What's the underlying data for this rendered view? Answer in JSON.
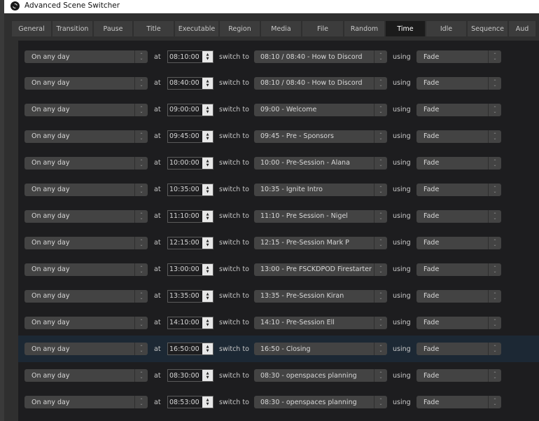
{
  "window": {
    "title": "Advanced Scene Switcher"
  },
  "tabs": [
    {
      "label": "General",
      "active": false
    },
    {
      "label": "Transition",
      "active": false
    },
    {
      "label": "Pause",
      "active": false
    },
    {
      "label": "Title",
      "active": false
    },
    {
      "label": "Executable",
      "active": false
    },
    {
      "label": "Region",
      "active": false
    },
    {
      "label": "Media",
      "active": false
    },
    {
      "label": "File",
      "active": false
    },
    {
      "label": "Random",
      "active": false
    },
    {
      "label": "Time",
      "active": true
    },
    {
      "label": "Idle",
      "active": false
    },
    {
      "label": "Sequence",
      "active": false
    },
    {
      "label": "Aud",
      "active": false
    }
  ],
  "labels": {
    "at": "at",
    "switch_to": "switch to",
    "using": "using"
  },
  "rows": [
    {
      "day": "On any day",
      "time": "08:10:00",
      "scene": "08:10 / 08:40 - How to Discord",
      "transition": "Fade",
      "selected": false
    },
    {
      "day": "On any day",
      "time": "08:40:00",
      "scene": "08:10 / 08:40 - How to Discord",
      "transition": "Fade",
      "selected": false
    },
    {
      "day": "On any day",
      "time": "09:00:00",
      "scene": "09:00 - Welcome",
      "transition": "Fade",
      "selected": false
    },
    {
      "day": "On any day",
      "time": "09:45:00",
      "scene": "09:45 - Pre  - Sponsors",
      "transition": "Fade",
      "selected": false
    },
    {
      "day": "On any day",
      "time": "10:00:00",
      "scene": "10:00 - Pre-Session - Alana",
      "transition": "Fade",
      "selected": false
    },
    {
      "day": "On any day",
      "time": "10:35:00",
      "scene": "10:35 - Ignite Intro",
      "transition": "Fade",
      "selected": false
    },
    {
      "day": "On any day",
      "time": "11:10:00",
      "scene": "11:10 - Pre Session - Nigel",
      "transition": "Fade",
      "selected": false
    },
    {
      "day": "On any day",
      "time": "12:15:00",
      "scene": "12:15 - Pre-Session Mark P",
      "transition": "Fade",
      "selected": false
    },
    {
      "day": "On any day",
      "time": "13:00:00",
      "scene": "13:00 - Pre FSCKDPOD Firestarter",
      "transition": "Fade",
      "selected": false
    },
    {
      "day": "On any day",
      "time": "13:35:00",
      "scene": "13:35 - Pre-Session Kiran",
      "transition": "Fade",
      "selected": false
    },
    {
      "day": "On any day",
      "time": "14:10:00",
      "scene": "14:10 - Pre-Session Ell",
      "transition": "Fade",
      "selected": false
    },
    {
      "day": "On any day",
      "time": "16:50:00",
      "scene": "16:50 - Closing",
      "transition": "Fade",
      "selected": true
    },
    {
      "day": "On any day",
      "time": "08:30:00",
      "scene": "08:30 - openspaces planning",
      "transition": "Fade",
      "selected": false
    },
    {
      "day": "On any day",
      "time": "08:53:00",
      "scene": "08:30 - openspaces planning",
      "transition": "Fade",
      "selected": false
    }
  ]
}
